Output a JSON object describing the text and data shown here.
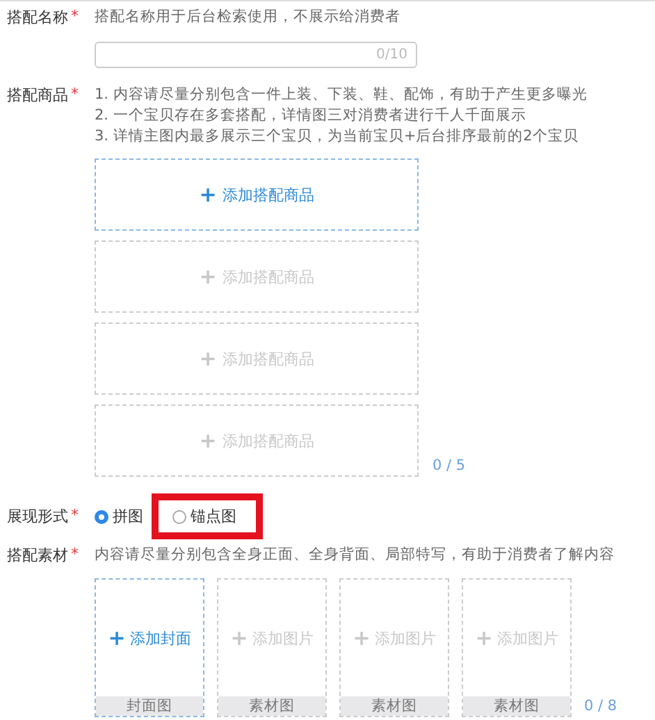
{
  "name_field": {
    "label": "搭配名称",
    "required": "*",
    "hint": "搭配名称用于后台检索使用，不展示给消费者",
    "counter": "0/10"
  },
  "products": {
    "label": "搭配商品",
    "required": "*",
    "notes": [
      "1. 内容请尽量分别包含一件上装、下装、鞋、配饰，有助于产生更多曝光",
      "2. 一个宝贝存在多套搭配，详情图三对消费者进行千人千面展示",
      "3. 详情主图内最多展示三个宝贝，为当前宝贝+后台排序最前的2个宝贝"
    ],
    "slots": [
      {
        "icon": "+",
        "label": "添加搭配商品",
        "disabled": false
      },
      {
        "icon": "+",
        "label": "添加搭配商品",
        "disabled": true
      },
      {
        "icon": "+",
        "label": "添加搭配商品",
        "disabled": true
      },
      {
        "icon": "+",
        "label": "添加搭配商品",
        "disabled": true
      }
    ],
    "counter": "0 / 5"
  },
  "display": {
    "label": "展现形式",
    "required": "*",
    "options": [
      {
        "label": "拼图",
        "selected": true,
        "highlighted": false
      },
      {
        "label": "锚点图",
        "selected": false,
        "highlighted": true
      }
    ]
  },
  "materials": {
    "label": "搭配素材",
    "required": "*",
    "hint": "内容请尽量分别包含全身正面、全身背面、局部特写，有助于消费者了解内容",
    "tiles": [
      {
        "icon": "+",
        "label": "添加封面",
        "caption": "封面图",
        "disabled": false
      },
      {
        "icon": "+",
        "label": "添加图片",
        "caption": "素材图",
        "disabled": true
      },
      {
        "icon": "+",
        "label": "添加图片",
        "caption": "素材图",
        "disabled": true
      },
      {
        "icon": "+",
        "label": "添加图片",
        "caption": "素材图",
        "disabled": true
      }
    ],
    "counter": "0 / 8"
  }
}
